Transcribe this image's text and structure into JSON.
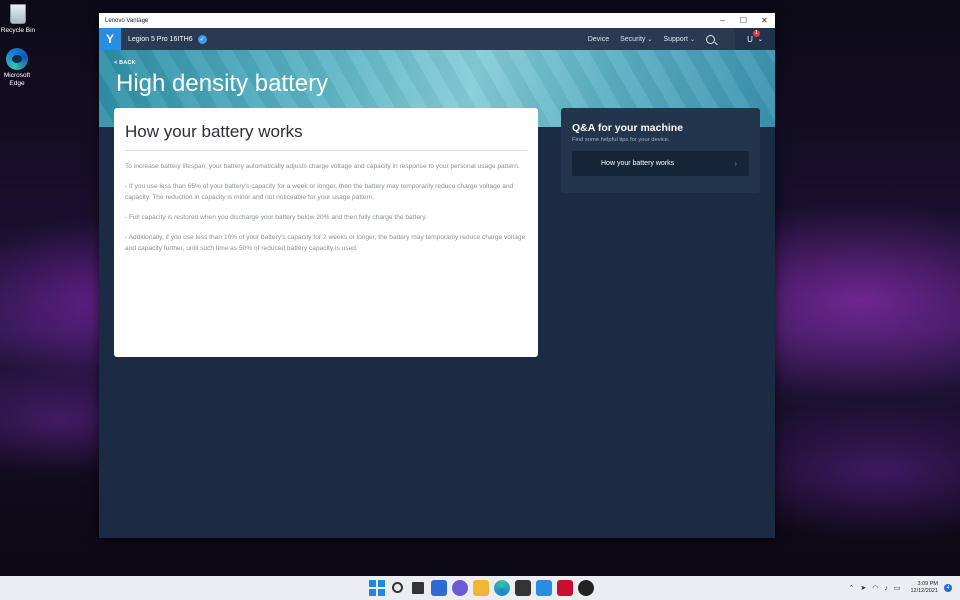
{
  "desktop": {
    "icons": [
      {
        "label": "Recycle Bin",
        "icon": "recycle-bin-icon"
      },
      {
        "label": "Microsoft Edge",
        "icon": "edge-icon"
      }
    ]
  },
  "window": {
    "title": "Lenovo Vantage",
    "controls": {
      "minimize": "–",
      "maximize": "☐",
      "close": "✕"
    }
  },
  "appbar": {
    "device_name": "Legion 5 Pro 16ITH6",
    "nav": [
      {
        "label": "Device"
      },
      {
        "label": "Security"
      },
      {
        "label": "Support"
      }
    ],
    "user_initial": "U",
    "notification_count": "1"
  },
  "hero": {
    "back_label": "< BACK",
    "title": "High density battery"
  },
  "card": {
    "title": "How your battery works",
    "paragraphs": [
      "To increase battery lifespan, your battery automatically adjusts charge voltage and capacity in response to your personal usage pattern.",
      "- If you use less than 65% of your battery's capacity for a week or longer, then the battery may temporarily reduce charge voltage and capacity. The reduction in capacity is minor and not noticeable for your usage pattern.",
      "- Full capacity is restored when you discharge your battery below 20% and then fully charge the battery.",
      "- Additionally, if you use less than 10% of your battery's capacity for 2 weeks or longer, the battery may temporarily reduce charge voltage and capacity further, until such time as 50% of reduced battery capacity is used."
    ]
  },
  "qa": {
    "title": "Q&A for your machine",
    "subtitle": "Find some helpful tips for your device.",
    "items": [
      {
        "label": "How your battery works"
      }
    ]
  },
  "taskbar": {
    "time": "3:09 PM",
    "date": "12/12/2021",
    "notification_count": "4"
  },
  "colors": {
    "accent": "#2a8ee0",
    "appbar": "#2a3a51",
    "window_bg": "#1b2b44",
    "qa_panel": "#23344d"
  }
}
